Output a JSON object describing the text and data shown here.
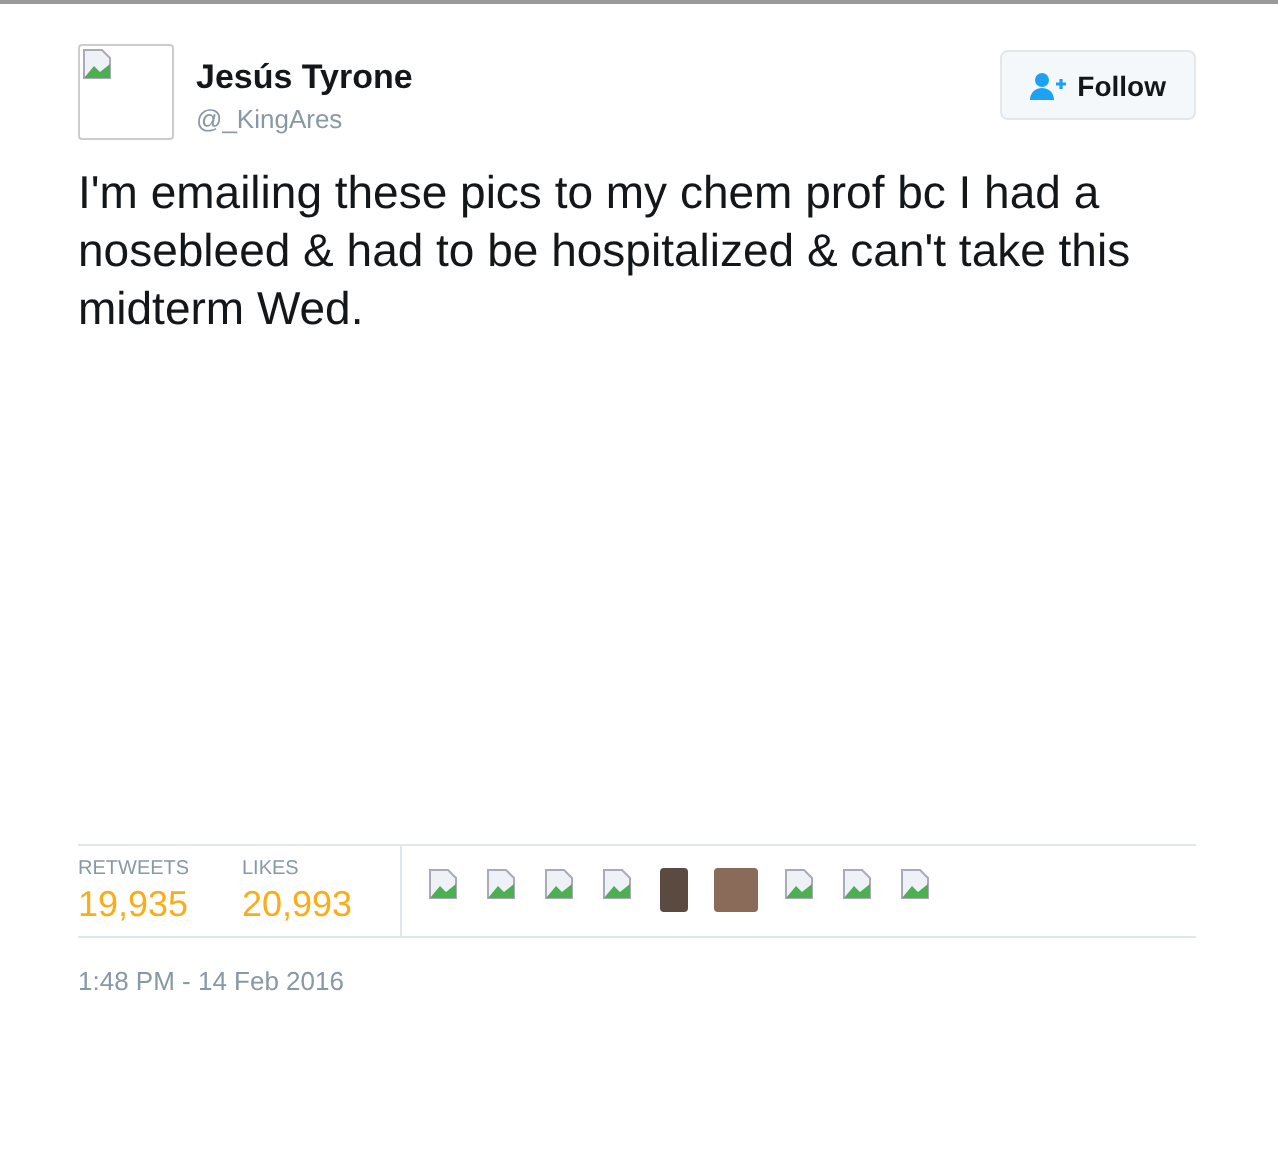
{
  "author": {
    "name": "Jesús Tyrone",
    "handle": "@_KingAres"
  },
  "follow_button": {
    "label": "Follow"
  },
  "tweet_text": "I'm emailing these pics to my chem prof bc I had a nosebleed & had to be hospitalized & can't take this midterm Wed.",
  "stats": [
    {
      "label": "RETWEETS",
      "value": "19,935"
    },
    {
      "label": "LIKES",
      "value": "20,993"
    }
  ],
  "likers": [
    {
      "kind": "broken"
    },
    {
      "kind": "broken"
    },
    {
      "kind": "broken"
    },
    {
      "kind": "broken"
    },
    {
      "kind": "photo"
    },
    {
      "kind": "photo"
    },
    {
      "kind": "broken"
    },
    {
      "kind": "broken"
    },
    {
      "kind": "broken"
    }
  ],
  "timestamp": "1:48 PM - 14 Feb 2016"
}
